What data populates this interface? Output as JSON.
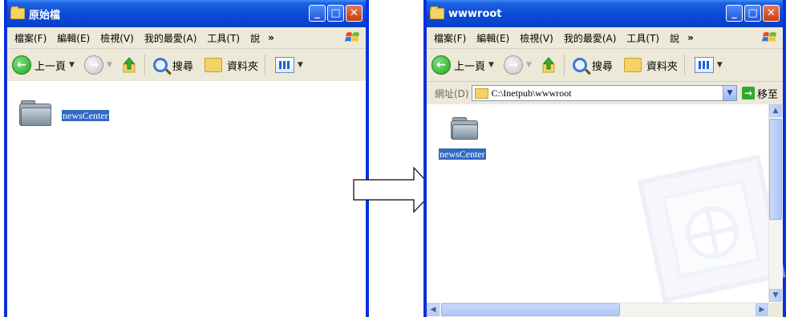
{
  "left_window": {
    "title": "原始檔",
    "menu": [
      "檔案(F)",
      "編輯(E)",
      "檢視(V)",
      "我的最愛(A)",
      "工具(T)",
      "說"
    ],
    "menu_more": "»",
    "toolbar": {
      "back": "上一頁",
      "search": "搜尋",
      "folders": "資料夾"
    },
    "item": {
      "name": "newsCenter"
    }
  },
  "right_window": {
    "title": "wwwroot",
    "menu": [
      "檔案(F)",
      "編輯(E)",
      "檢視(V)",
      "我的最愛(A)",
      "工具(T)",
      "說"
    ],
    "menu_more": "»",
    "toolbar": {
      "back": "上一頁",
      "search": "搜尋",
      "folders": "資料夾"
    },
    "address": {
      "label": "網址(D)",
      "value": "C:\\Inetpub\\wwwroot",
      "go": "移至"
    },
    "item": {
      "name": "newsCenter"
    }
  },
  "icons": {
    "minimize": "minimize-icon",
    "maximize": "maximize-icon",
    "close": "close-icon",
    "back": "back-arrow-icon",
    "forward": "forward-arrow-icon",
    "up": "up-folder-icon",
    "search": "search-icon",
    "folders": "folders-icon",
    "views": "views-icon",
    "arrow": "right-arrow-icon"
  },
  "colors": {
    "titlebar": "#0a4ad8",
    "frame": "#0831d9",
    "selection": "#316ac5",
    "menubar": "#ece9d8"
  }
}
